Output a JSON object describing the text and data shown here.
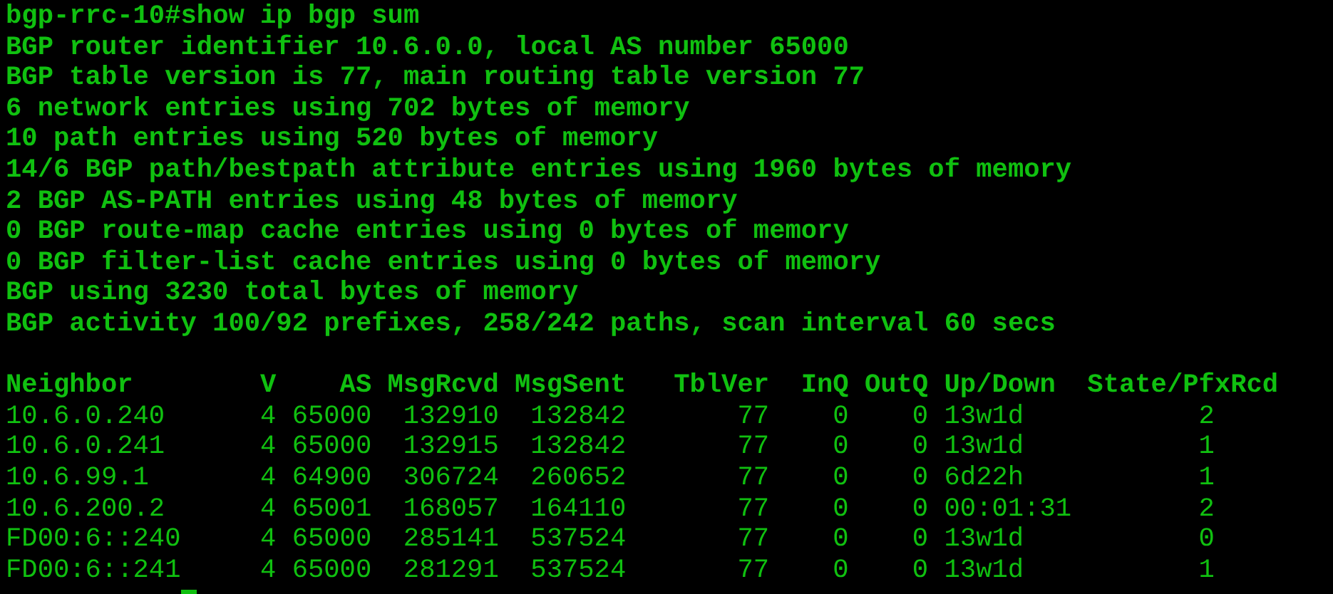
{
  "prompt": {
    "host": "bgp-rrc-10#",
    "command": "show ip bgp sum"
  },
  "summary_lines": [
    "BGP router identifier 10.6.0.0, local AS number 65000",
    "BGP table version is 77, main routing table version 77",
    "6 network entries using 702 bytes of memory",
    "10 path entries using 520 bytes of memory",
    "14/6 BGP path/bestpath attribute entries using 1960 bytes of memory",
    "2 BGP AS-PATH entries using 48 bytes of memory",
    "0 BGP route-map cache entries using 0 bytes of memory",
    "0 BGP filter-list cache entries using 0 bytes of memory",
    "BGP using 3230 total bytes of memory",
    "BGP activity 100/92 prefixes, 258/242 paths, scan interval 60 secs"
  ],
  "table": {
    "columns": [
      "Neighbor",
      "V",
      "AS",
      "MsgRcvd",
      "MsgSent",
      "TblVer",
      "InQ",
      "OutQ",
      "Up/Down",
      "State/PfxRcd"
    ],
    "rows": [
      [
        "10.6.0.240",
        "4",
        "65000",
        "132910",
        "132842",
        "77",
        "0",
        "0",
        "13w1d",
        "2"
      ],
      [
        "10.6.0.241",
        "4",
        "65000",
        "132915",
        "132842",
        "77",
        "0",
        "0",
        "13w1d",
        "1"
      ],
      [
        "10.6.99.1",
        "4",
        "64900",
        "306724",
        "260652",
        "77",
        "0",
        "0",
        "6d22h",
        "1"
      ],
      [
        "10.6.200.2",
        "4",
        "65001",
        "168057",
        "164110",
        "77",
        "0",
        "0",
        "00:01:31",
        "2"
      ],
      [
        "FD00:6::240",
        "4",
        "65000",
        "285141",
        "537524",
        "77",
        "0",
        "0",
        "13w1d",
        "0"
      ],
      [
        "FD00:6::241",
        "4",
        "65000",
        "281291",
        "537524",
        "77",
        "0",
        "0",
        "13w1d",
        "1"
      ]
    ]
  }
}
